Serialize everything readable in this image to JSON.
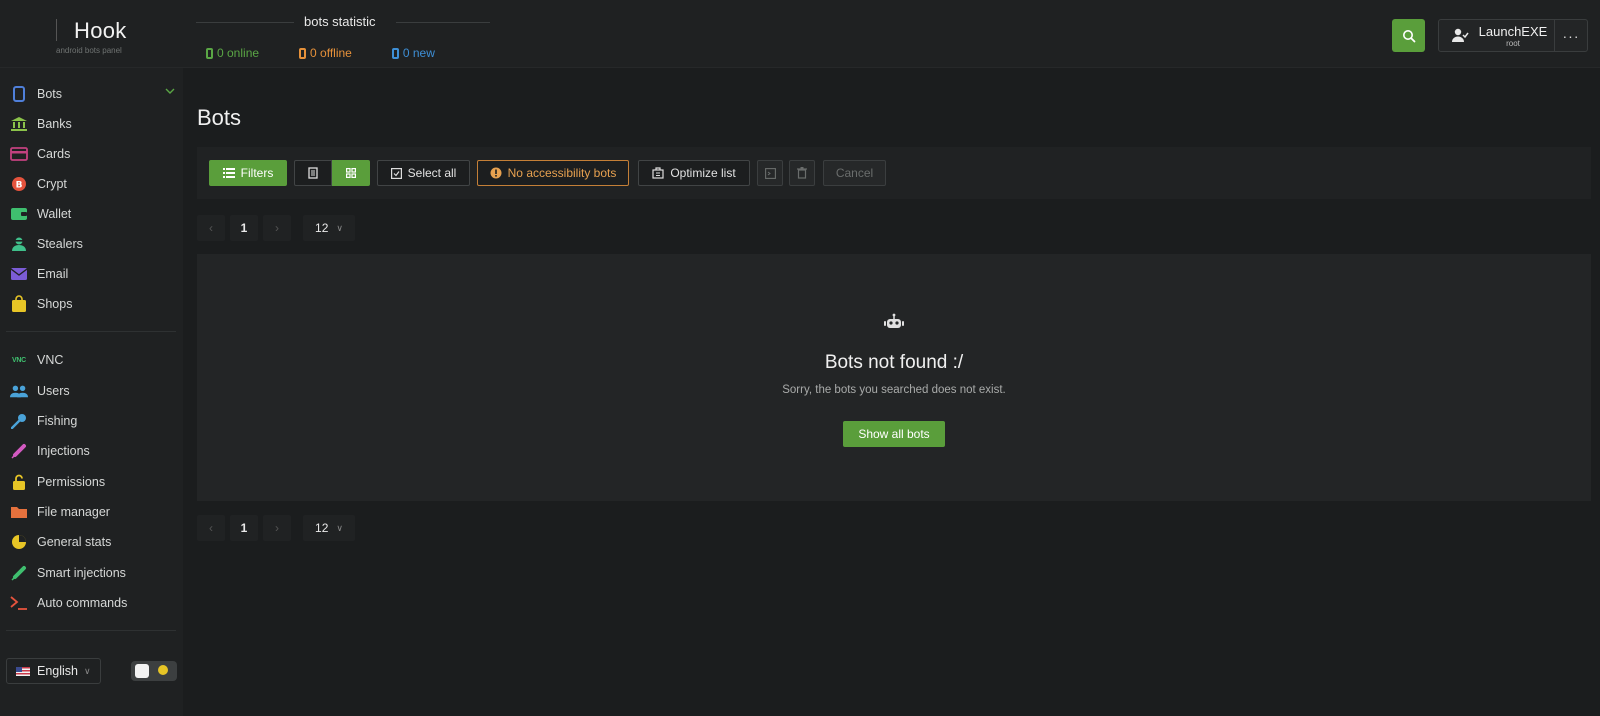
{
  "app": {
    "name": "Hook",
    "subtitle": "android bots panel"
  },
  "stats": {
    "title": "bots statistic",
    "online": "0 online",
    "offline": "0 offline",
    "new": "0 new"
  },
  "user": {
    "name": "LaunchEXE",
    "role": "root",
    "more": "···"
  },
  "sidebar": {
    "items": [
      {
        "label": "Bots",
        "icon": "phone-icon"
      },
      {
        "label": "Banks",
        "icon": "bank-icon"
      },
      {
        "label": "Cards",
        "icon": "card-icon"
      },
      {
        "label": "Crypt",
        "icon": "bitcoin-icon"
      },
      {
        "label": "Wallet",
        "icon": "wallet-icon"
      },
      {
        "label": "Stealers",
        "icon": "stealer-icon"
      },
      {
        "label": "Email",
        "icon": "email-icon"
      },
      {
        "label": "Shops",
        "icon": "shop-icon"
      },
      {
        "label": "VNC",
        "icon": "vnc-icon"
      },
      {
        "label": "Users",
        "icon": "users-icon"
      },
      {
        "label": "Fishing",
        "icon": "key-icon"
      },
      {
        "label": "Injections",
        "icon": "syringe-icon"
      },
      {
        "label": "Permissions",
        "icon": "lock-icon"
      },
      {
        "label": "File manager",
        "icon": "folder-icon"
      },
      {
        "label": "General stats",
        "icon": "pie-chart-icon"
      },
      {
        "label": "Smart injections",
        "icon": "smart-syringe-icon"
      },
      {
        "label": "Auto commands",
        "icon": "terminal-icon"
      }
    ],
    "vnc_badge": "VNC",
    "language": "English"
  },
  "main": {
    "title": "Bots",
    "toolbar": {
      "filters": "Filters",
      "select_all": "Select all",
      "no_accessibility": "No accessibility bots",
      "optimize": "Optimize list",
      "cancel": "Cancel"
    },
    "pager": {
      "page": "1",
      "size": "12",
      "prev": "‹",
      "next": "›"
    },
    "empty": {
      "title": "Bots not found :/",
      "subtitle": "Sorry, the bots you searched does not exist.",
      "button": "Show all bots"
    }
  },
  "colors": {
    "accent": "#5a9e3b",
    "online": "#5aa645",
    "offline": "#e6913a",
    "new": "#3e8fd6",
    "warning": "#e7a150"
  }
}
